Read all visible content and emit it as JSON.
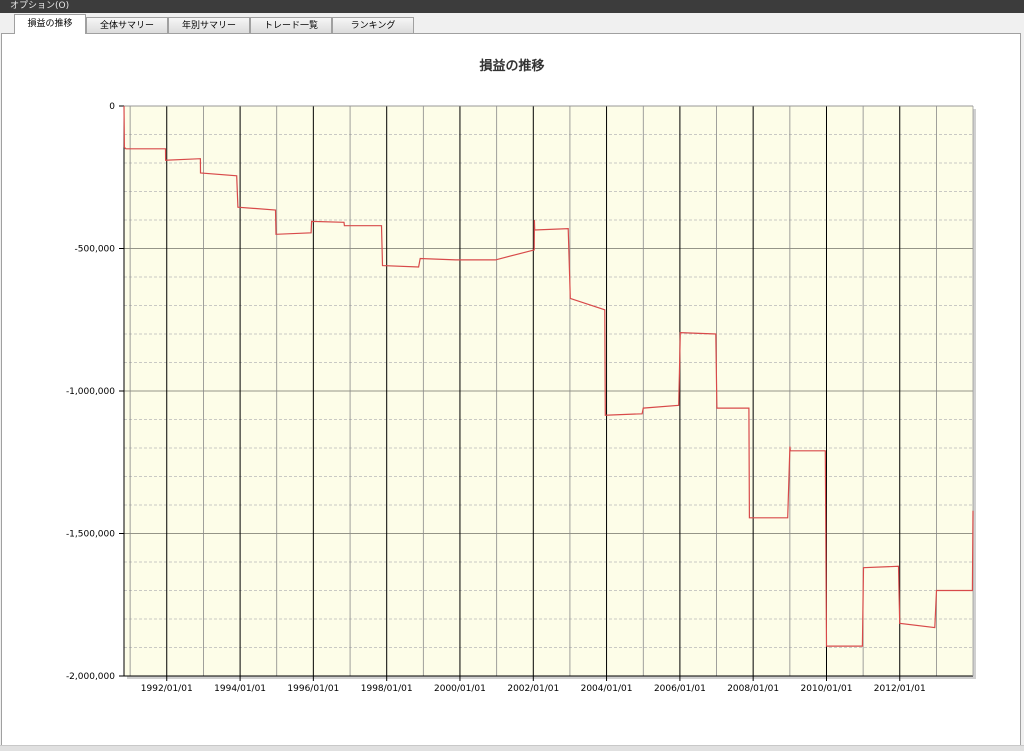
{
  "menu": {
    "options_label": "オプション(O)"
  },
  "tabs": [
    {
      "label": "損益の推移",
      "active": true
    },
    {
      "label": "全体サマリー",
      "active": false
    },
    {
      "label": "年別サマリー",
      "active": false
    },
    {
      "label": "トレード一覧",
      "active": false
    },
    {
      "label": "ランキング",
      "active": false
    }
  ],
  "colors": {
    "plot_background": "#fdfde8",
    "line": "#d84a4a",
    "major_grid": "#000000",
    "minor_grid": "#b8b8b8"
  },
  "chart_data": {
    "type": "line",
    "title": "損益の推移",
    "xlabel": "",
    "ylabel": "",
    "ylim": [
      -2000000,
      0
    ],
    "xlim": [
      "1990-11-01",
      "2013-12-31"
    ],
    "y_ticks": [
      0,
      -500000,
      -1000000,
      -1500000,
      -2000000
    ],
    "y_tick_labels": [
      "0",
      "-500,000",
      "-1,000,000",
      "-1,500,000",
      "-2,000,000"
    ],
    "x_ticks": [
      "1992-01-01",
      "1994-01-01",
      "1996-01-01",
      "1998-01-01",
      "2000-01-01",
      "2002-01-01",
      "2004-01-01",
      "2006-01-01",
      "2008-01-01",
      "2010-01-01",
      "2012-01-01"
    ],
    "x_tick_labels": [
      "1992/01/01",
      "1994/01/01",
      "1996/01/01",
      "1998/01/01",
      "2000/01/01",
      "2002/01/01",
      "2004/01/01",
      "2006/01/01",
      "2008/01/01",
      "2010/01/01",
      "2012/01/01"
    ],
    "grid": true,
    "legend": "none",
    "series": [
      {
        "x": [
          "1990-11-01",
          "1990-11-05",
          "1990-11-20",
          "1991-12-20",
          "1991-12-21",
          "1992-12-01",
          "1992-12-02",
          "1993-11-28",
          "1993-12-10",
          "1994-12-20",
          "1994-12-25",
          "1995-12-10",
          "1995-12-15",
          "1996-11-01",
          "1996-11-05",
          "1997-11-10",
          "1997-11-20",
          "1998-11-15",
          "1998-12-01",
          "1999-11-20",
          "1999-12-10",
          "2000-12-20",
          "2002-01-10",
          "2002-01-12",
          "2002-01-15",
          "2002-12-15",
          "2003-01-05",
          "2003-12-15",
          "2003-12-20",
          "2004-12-20",
          "2005-01-01",
          "2005-12-20",
          "2006-01-05",
          "2006-12-25",
          "2007-01-05",
          "2007-11-20",
          "2007-11-25",
          "2008-12-10",
          "2009-01-01",
          "2009-01-05",
          "2009-12-20",
          "2010-01-01",
          "2010-12-25",
          "2011-01-05",
          "2011-12-20",
          "2012-01-01",
          "2012-12-15",
          "2013-01-01",
          "2013-12-25",
          "2013-12-31"
        ],
        "y": [
          0,
          -145000,
          -150000,
          -150000,
          -190000,
          -185000,
          -235000,
          -245000,
          -355000,
          -365000,
          -450000,
          -445000,
          -405000,
          -408000,
          -420000,
          -420000,
          -560000,
          -565000,
          -535000,
          -540000,
          -540000,
          -540000,
          -505000,
          -400000,
          -435000,
          -430000,
          -675000,
          -715000,
          -1085000,
          -1080000,
          -1060000,
          -1050000,
          -795000,
          -800000,
          -1060000,
          -1060000,
          -1445000,
          -1445000,
          -1195000,
          -1210000,
          -1210000,
          -1895000,
          -1895000,
          -1620000,
          -1615000,
          -1815000,
          -1830000,
          -1700000,
          -1700000,
          -1420000
        ]
      }
    ]
  }
}
